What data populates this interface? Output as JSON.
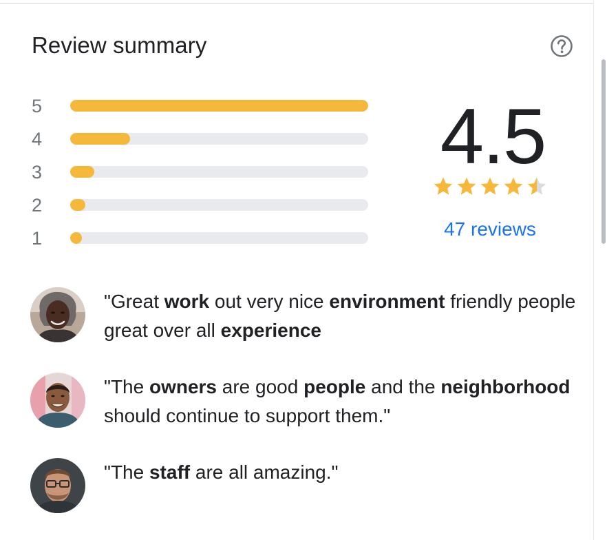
{
  "title": "Review summary",
  "help_icon": "help-circle-icon",
  "distribution": [
    {
      "stars": "5",
      "fraction": 1.0
    },
    {
      "stars": "4",
      "fraction": 0.2
    },
    {
      "stars": "3",
      "fraction": 0.08
    },
    {
      "stars": "2",
      "fraction": 0.05
    },
    {
      "stars": "1",
      "fraction": 0.02
    }
  ],
  "rating": {
    "value": "4.5",
    "stars_filled": 4.5,
    "stars_total": 5,
    "reviews_label": "47 reviews"
  },
  "colors": {
    "bar_fill": "#f5b83d",
    "bar_track": "#e8eaed",
    "star": "#f5b83d",
    "link": "#1a73e8"
  },
  "snippets": [
    {
      "avatar": "reviewer-avatar-1",
      "parts": [
        {
          "text": "\"Great ",
          "bold": false
        },
        {
          "text": "work",
          "bold": true
        },
        {
          "text": " out very nice ",
          "bold": false
        },
        {
          "text": "environment",
          "bold": true
        },
        {
          "text": " friendly people great over all ",
          "bold": false
        },
        {
          "text": "experience",
          "bold": true
        }
      ]
    },
    {
      "avatar": "reviewer-avatar-2",
      "parts": [
        {
          "text": "\"The ",
          "bold": false
        },
        {
          "text": "owners",
          "bold": true
        },
        {
          "text": " are good ",
          "bold": false
        },
        {
          "text": "people",
          "bold": true
        },
        {
          "text": " and the ",
          "bold": false
        },
        {
          "text": "neighborhood",
          "bold": true
        },
        {
          "text": " should continue to support them.\"",
          "bold": false
        }
      ]
    },
    {
      "avatar": "reviewer-avatar-3",
      "parts": [
        {
          "text": "\"The ",
          "bold": false
        },
        {
          "text": "staff",
          "bold": true
        },
        {
          "text": " are all amazing.\"",
          "bold": false
        }
      ]
    }
  ]
}
